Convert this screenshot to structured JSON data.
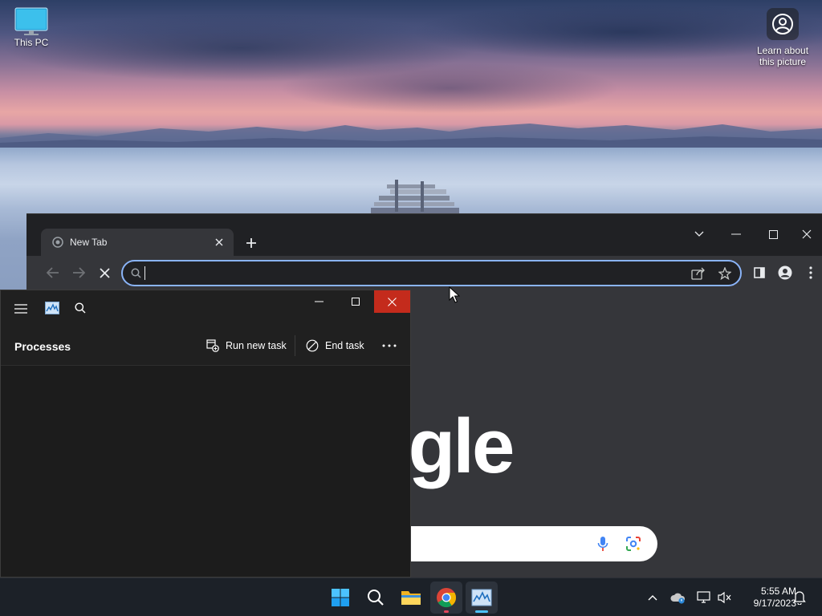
{
  "desktop": {
    "this_pc_label": "This PC",
    "learn_label_line1": "Learn about",
    "learn_label_line2": "this picture"
  },
  "chrome": {
    "tab_title": "New Tab",
    "address_value": "",
    "google_text": "ogle"
  },
  "task_manager": {
    "page_title": "Processes",
    "run_new_task_label": "Run new task",
    "end_task_label": "End task"
  },
  "taskbar": {
    "time": "5:55 AM",
    "date": "9/17/2023",
    "apps": [
      "start-icon",
      "search-icon",
      "file-explorer-icon",
      "chrome-icon",
      "task-manager-icon"
    ]
  },
  "colors": {
    "accent_blue": "#8ab4f8",
    "close_red": "#c42b1c",
    "chrome_dark": "#202124",
    "chrome_toolbar": "#35363a",
    "taskbar": "#1c2128"
  }
}
